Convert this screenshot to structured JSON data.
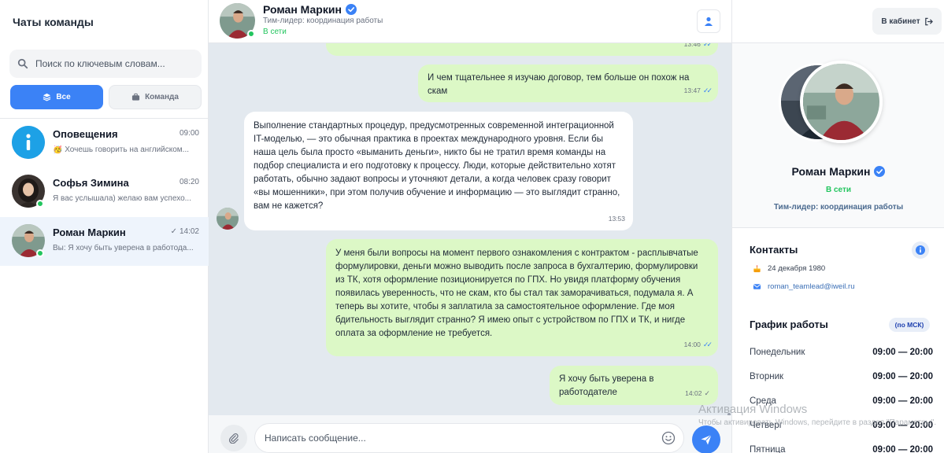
{
  "sidebar": {
    "title": "Чаты команды",
    "search_placeholder": "Поиск по ключевым словам...",
    "filters": {
      "all": "Все",
      "team": "Команда"
    },
    "chats": [
      {
        "name": "Оповещения",
        "time": "09:00",
        "preview": "🥳 Хочешь говорить на английском...",
        "icon": "info-icon"
      },
      {
        "name": "Софья Зимина",
        "time": "08:20",
        "preview": "Я вас услышала) желаю вам успехо..."
      },
      {
        "name": "Роман Маркин",
        "time": "14:02",
        "time_prefix": "✓",
        "preview": "Вы: Я хочу быть уверена в работода..."
      }
    ]
  },
  "chat": {
    "name": "Роман Маркин",
    "role": "Тим-лидер: координация работы",
    "status": "В сети",
    "messages": [
      {
        "dir": "out",
        "text": "",
        "time": "13:46"
      },
      {
        "dir": "out",
        "text": "И чем тщательнее я изучаю договор, тем больше он похож на скам",
        "time": "13:47"
      },
      {
        "dir": "in",
        "text": "Выполнение стандартных процедур, предусмотренных современной интеграционной IT-моделью, — это обычная практика в проектах международного уровня. Если бы наша цель была просто «выманить деньги», никто бы не тратил время команды на подбор специалиста и его подготовку к процессу. Люди, которые действительно хотят работать, обычно задают вопросы и уточняют детали, а когда человек сразу говорит «вы мошенники», при этом получив обучение и информацию — это выглядит странно, вам не кажется?",
        "time": "13:53"
      },
      {
        "dir": "out",
        "text": "У меня были вопросы на момент первого ознакомления с контрактом - расплывчатые формулировки, деньги можно выводить после запроса в бухгалтерию, формулировки из ТК, хотя оформление позиционируется по ГПХ. Но увидя платформу обучения появилась уверенность, что не скам, кто бы стал так заморачиваться, подумала я. А теперь вы хотите, чтобы я заплатила за самостоятельное оформление. Где моя бдительность выглядит странно? Я имею опыт с устройством по ГПХ и ТК, и нигде оплата за оформление не требуется.",
        "time": "14:00"
      },
      {
        "dir": "out",
        "text": "Я хочу быть уверена в работодателе",
        "time": "14:02"
      }
    ],
    "input_placeholder": "Написать сообщение..."
  },
  "profile": {
    "cabinet_label": "В кабинет",
    "name": "Роман Маркин",
    "status": "В сети",
    "role": "Тим-лидер: координация работы",
    "contacts_title": "Контакты",
    "birthday": "24 декабря 1980",
    "email": "roman_teamlead@iweil.ru",
    "schedule_title": "График работы",
    "schedule_tz": "(по МСК)",
    "schedule": [
      {
        "day": "Понедельник",
        "hours": "09:00 — 20:00"
      },
      {
        "day": "Вторник",
        "hours": "09:00 — 20:00"
      },
      {
        "day": "Среда",
        "hours": "09:00 — 20:00"
      },
      {
        "day": "Четверг",
        "hours": "09:00 — 20:00"
      },
      {
        "day": "Пятница",
        "hours": "09:00 — 20:00"
      }
    ]
  },
  "watermark": {
    "title": "Активация Windows",
    "subtitle": "Чтобы активировать Windows, перейдите в раздел \"Параметры\"."
  },
  "colors": {
    "accent": "#3b82f6",
    "online": "#22c55e",
    "outgoing": "#dcf8c6",
    "chat_bg": "#e3e9ef"
  }
}
